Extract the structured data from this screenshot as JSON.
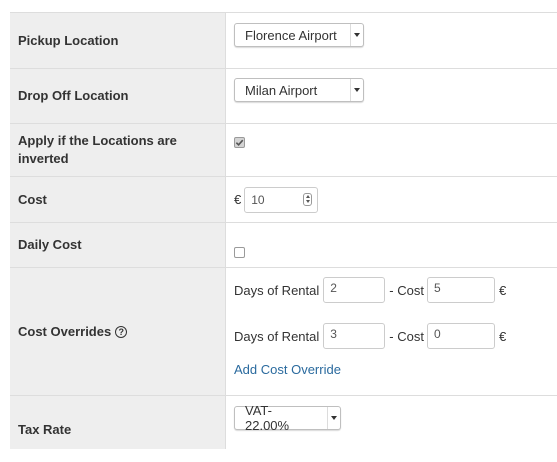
{
  "rows": {
    "pickup": {
      "label": "Pickup Location",
      "value": "Florence Airport"
    },
    "dropoff": {
      "label": "Drop Off Location",
      "value": "Milan Airport"
    },
    "inverted": {
      "label": "Apply if the Locations are inverted",
      "checked": true
    },
    "cost": {
      "label": "Cost",
      "currency": "€",
      "value": "10"
    },
    "daily_cost": {
      "label": "Daily Cost",
      "checked": false
    },
    "overrides": {
      "label": "Cost Overrides",
      "help_icon": "question-circle-icon",
      "days_label": "Days of Rental",
      "cost_label": "- Cost",
      "currency": "€",
      "items": [
        {
          "days": "2",
          "cost": "5"
        },
        {
          "days": "3",
          "cost": "0"
        }
      ],
      "add_link": "Add Cost Override"
    },
    "tax": {
      "label": "Tax Rate",
      "value": "VAT-22.00%"
    }
  },
  "colors": {
    "label_bg": "#eeeeee",
    "border": "#dddddd",
    "link": "#2a6a9e"
  }
}
